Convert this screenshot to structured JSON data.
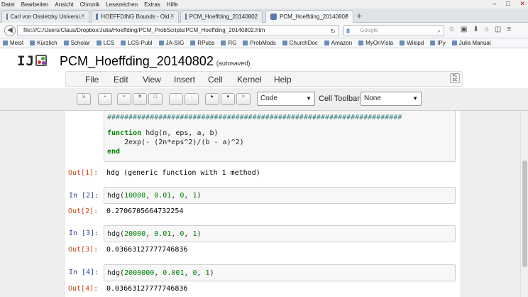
{
  "menubar": [
    "Datei",
    "Bearbeiten",
    "Ansicht",
    "Chronik",
    "Lesezeichen",
    "Extras",
    "Hilfe"
  ],
  "window_controls": [
    "–",
    "□",
    "✕"
  ],
  "tabs": [
    {
      "label": "Carl von Ossietzky Universi..."
    },
    {
      "label": "HOEFFDING Bounds - Old..."
    },
    {
      "label": "PCM_Hoeffding_20140802"
    },
    {
      "label": "PCM_Hoeffding_20140802"
    }
  ],
  "new_tab": "+",
  "nav": {
    "url": "file:///C:/Users/Claus/Dropbox/Julia/Hoeffding/PCM_ProbScripts/PCM_Hoeffding_20140802.htm",
    "search_placeholder": "Google",
    "search_engine": "8",
    "icons": [
      "☆",
      "▣",
      "⬇",
      "⌂",
      "◫",
      "≡"
    ]
  },
  "bookmarks": [
    "Meist",
    "Kürzlich",
    "Scholar",
    "LCS",
    "LCS-Publ",
    "JA-SIG",
    "RPubs",
    "RG",
    "ProbMods",
    "ChurchDoc",
    "Amazon",
    "MyOnVista",
    "Wikipd",
    "IPy",
    "Julia Manual"
  ],
  "notebook": {
    "logo": "IJ",
    "title": "PCM_Hoeffding_20140802",
    "autosaved": "(autosaved)",
    "menu": [
      "File",
      "Edit",
      "View",
      "Insert",
      "Cell",
      "Kernel",
      "Help"
    ],
    "cell_type": "Code",
    "cell_toolbar_label": "Cell Toolbar:",
    "cell_toolbar_value": "None",
    "toolbar_buttons": [
      [
        "🖫",
        ""
      ],
      [
        "+",
        ""
      ],
      [
        "✂",
        ""
      ],
      [
        "⧉",
        ""
      ],
      [
        "📋",
        ""
      ],
      [
        "↑",
        ""
      ],
      [
        "↓",
        ""
      ],
      [
        "▶",
        ""
      ],
      [
        "■",
        ""
      ],
      [
        "↻",
        ""
      ]
    ]
  },
  "cells": {
    "c1_comment_partial": "# ----------",
    "c1_comment": "#####################################################################",
    "c1_line1": [
      "function",
      " hdg(n, eps, a, b)"
    ],
    "c1_line2": "    2exp(- (2n*eps^2)/(b - a)^2)",
    "c1_line3": "end",
    "out1_prompt": "Out[1]:",
    "out1_text": "hdg (generic function with 1 method)",
    "in2_prompt": "In [2]:",
    "in2_code": [
      "hdg(",
      "10000",
      ", ",
      "0.01",
      ", ",
      "0",
      ", ",
      "1",
      ")"
    ],
    "out2_prompt": "Out[2]:",
    "out2_text": "0.2706705664732254",
    "in3_prompt": "In [3]:",
    "in3_code": [
      "hdg(",
      "20000",
      ", ",
      "0.01",
      ", ",
      "0",
      ", ",
      "1",
      ")"
    ],
    "out3_prompt": "Out[3]:",
    "out3_text": "0.03663127777746836",
    "in4_prompt": "In [4]:",
    "in4_code": [
      "hdg(",
      "2000000",
      ", ",
      "0.001",
      ", ",
      "0",
      ", ",
      "1",
      ")"
    ],
    "out4_prompt": "Out[4]:",
    "out4_text": "0.03663127777746836"
  },
  "colors": {
    "prompt_in": "#303f9f",
    "prompt_out": "#d84315",
    "keyword": "#008000"
  }
}
